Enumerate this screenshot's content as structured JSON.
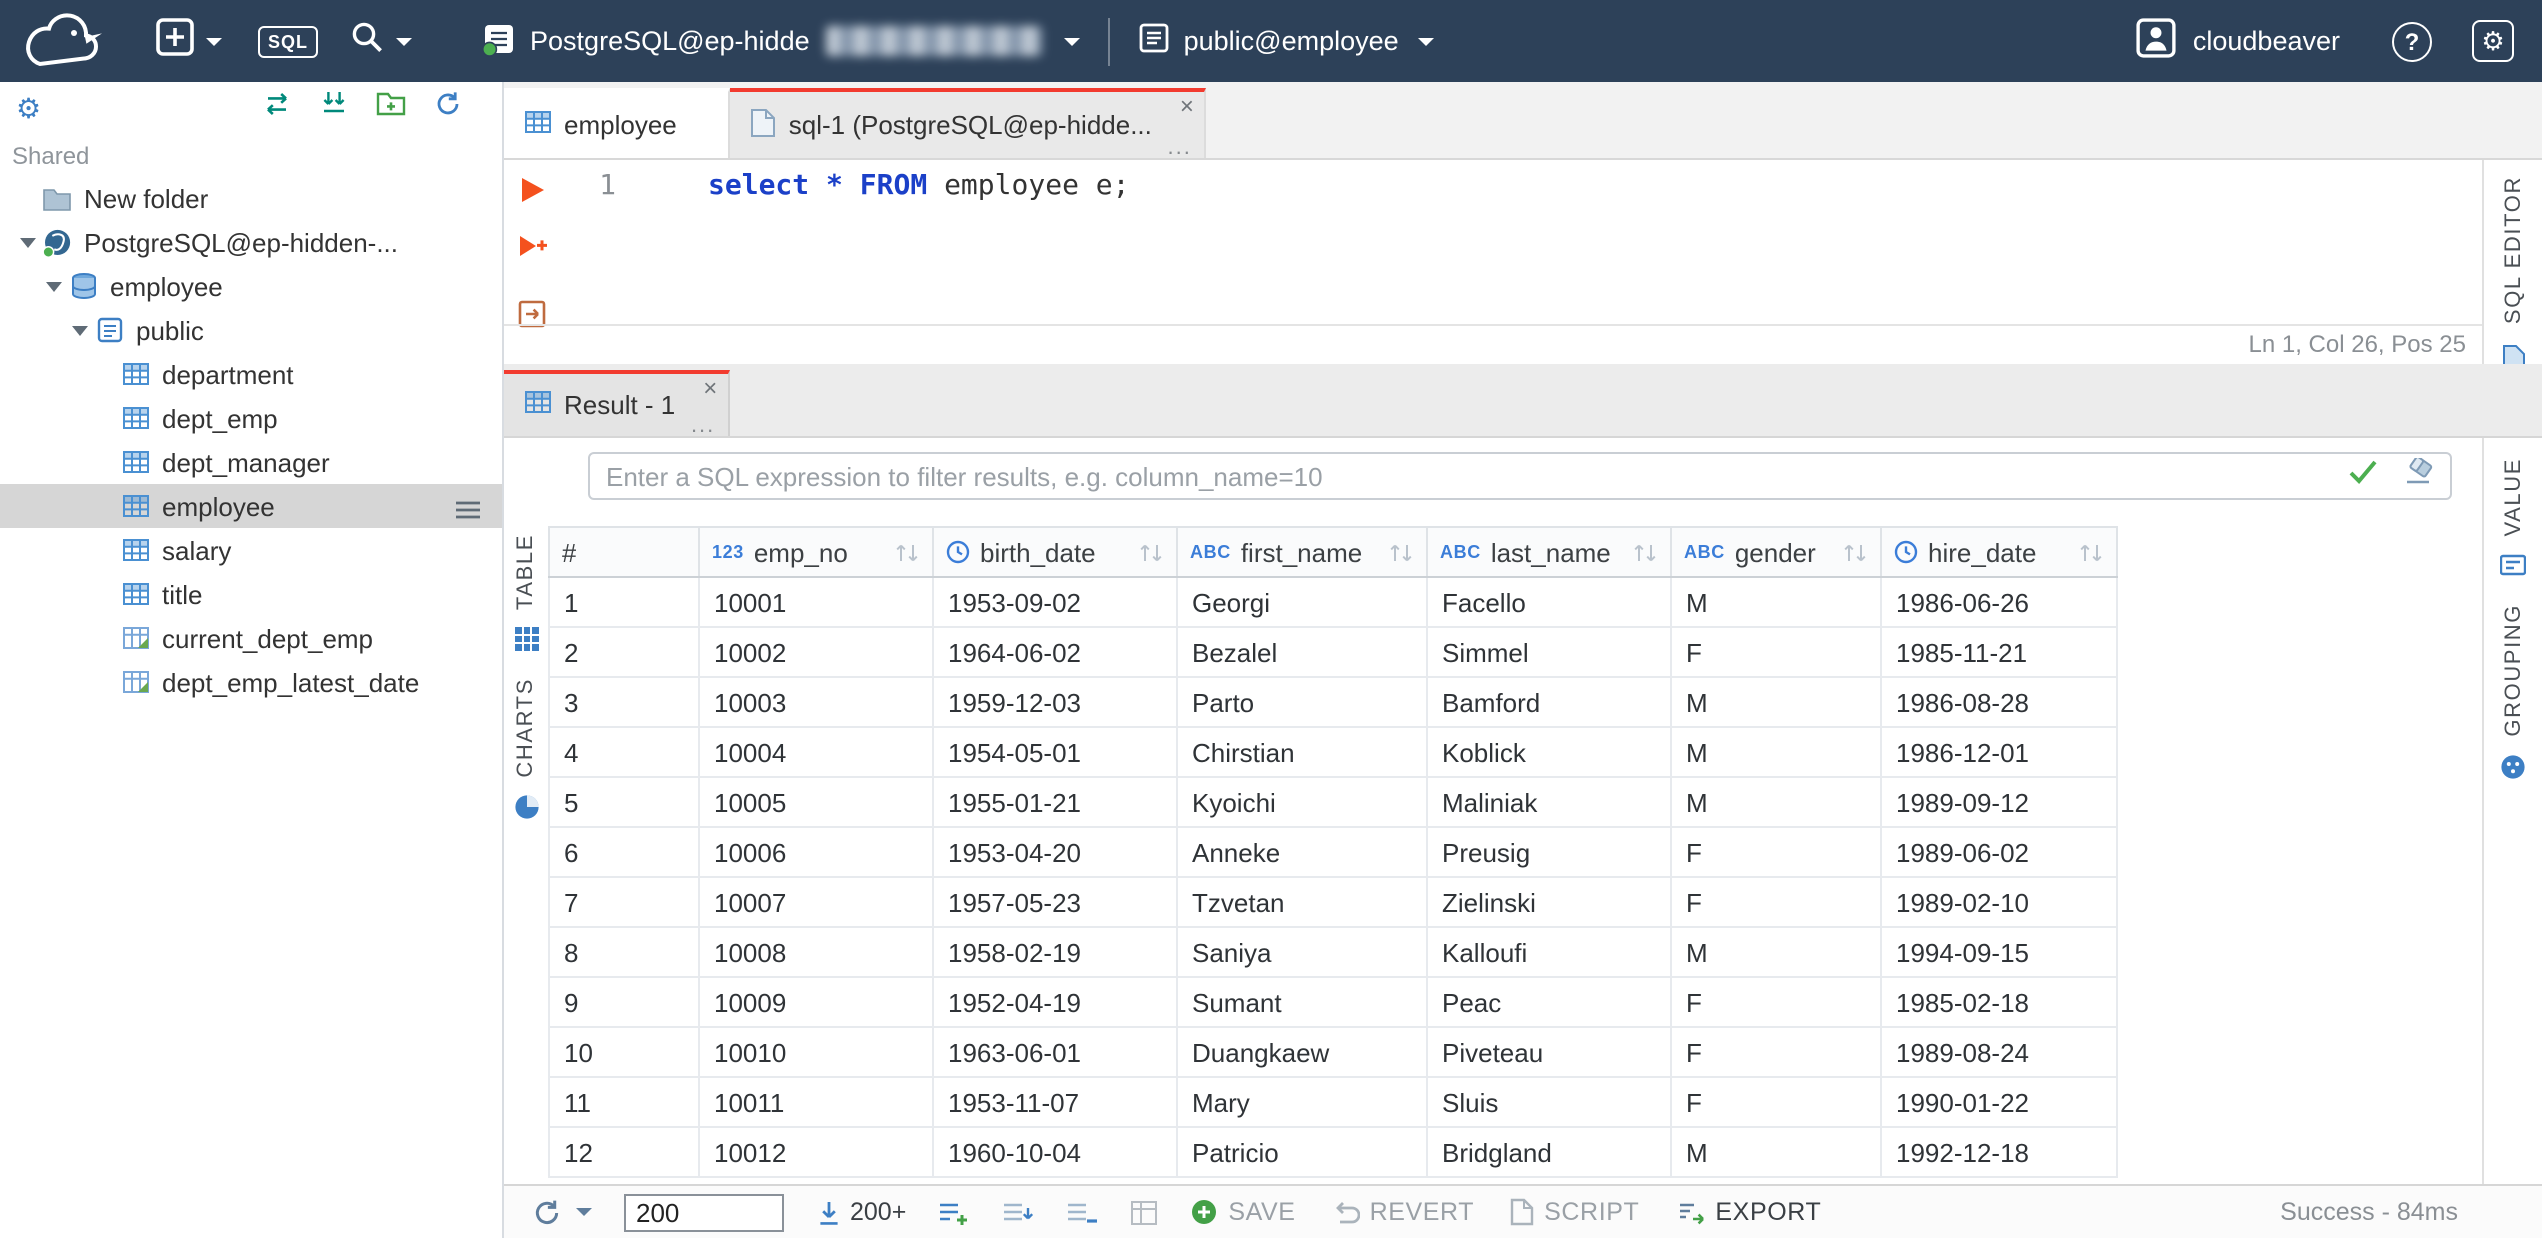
{
  "topbar": {
    "sql_badge": "SQL",
    "connection_name": "PostgreSQL@ep-hidde",
    "schema_selector": "public@employee",
    "user_name": "cloudbeaver",
    "help_label": "?"
  },
  "sidebar": {
    "section_label": "Shared",
    "tree": [
      {
        "label": "New folder",
        "icon": "folder",
        "indent": 0,
        "chevron": false
      },
      {
        "label": "PostgreSQL@ep-hidden-...",
        "icon": "postgres",
        "indent": 0,
        "chevron": true,
        "expanded": true
      },
      {
        "label": "employee",
        "icon": "database",
        "indent": 1,
        "chevron": true,
        "expanded": true
      },
      {
        "label": "public",
        "icon": "schema",
        "indent": 2,
        "chevron": true,
        "expanded": true
      },
      {
        "label": "department",
        "icon": "table",
        "indent": 3,
        "chevron": false
      },
      {
        "label": "dept_emp",
        "icon": "table",
        "indent": 3,
        "chevron": false
      },
      {
        "label": "dept_manager",
        "icon": "table",
        "indent": 3,
        "chevron": false
      },
      {
        "label": "employee",
        "icon": "table",
        "indent": 3,
        "chevron": false,
        "selected": true
      },
      {
        "label": "salary",
        "icon": "table",
        "indent": 3,
        "chevron": false
      },
      {
        "label": "title",
        "icon": "table",
        "indent": 3,
        "chevron": false
      },
      {
        "label": "current_dept_emp",
        "icon": "view",
        "indent": 3,
        "chevron": false
      },
      {
        "label": "dept_emp_latest_date",
        "icon": "view",
        "indent": 3,
        "chevron": false
      }
    ]
  },
  "tabs": {
    "items": [
      {
        "label": "employee",
        "active": false
      },
      {
        "label": "sql-1 (PostgreSQL@ep-hidde...",
        "active": true,
        "close": "×",
        "more": "..."
      }
    ]
  },
  "editor": {
    "line_number": "1",
    "tokens": [
      {
        "text": "select",
        "type": "kw"
      },
      {
        "text": " ",
        "type": "pl"
      },
      {
        "text": "*",
        "type": "kw"
      },
      {
        "text": " ",
        "type": "pl"
      },
      {
        "text": "FROM",
        "type": "kw"
      },
      {
        "text": " employee e;",
        "type": "pl"
      }
    ],
    "status": "Ln 1, Col 26, Pos 25",
    "rail_label": "SQL EDITOR"
  },
  "result": {
    "tab_label": "Result - 1",
    "tab_close": "×",
    "tab_more": "...",
    "filter_placeholder": "Enter a SQL expression to filter results, e.g. column_name=10",
    "rails": {
      "table": "TABLE",
      "charts": "CHARTS",
      "value": "VALUE",
      "grouping": "GROUPING"
    },
    "grid": {
      "columns": [
        {
          "name": "#",
          "type": ""
        },
        {
          "name": "emp_no",
          "type": "123"
        },
        {
          "name": "birth_date",
          "type": "date"
        },
        {
          "name": "first_name",
          "type": "ABC"
        },
        {
          "name": "last_name",
          "type": "ABC"
        },
        {
          "name": "gender",
          "type": "ABC"
        },
        {
          "name": "hire_date",
          "type": "date"
        }
      ],
      "rows": [
        [
          "1",
          "10001",
          "1953-09-02",
          "Georgi",
          "Facello",
          "M",
          "1986-06-26"
        ],
        [
          "2",
          "10002",
          "1964-06-02",
          "Bezalel",
          "Simmel",
          "F",
          "1985-11-21"
        ],
        [
          "3",
          "10003",
          "1959-12-03",
          "Parto",
          "Bamford",
          "M",
          "1986-08-28"
        ],
        [
          "4",
          "10004",
          "1954-05-01",
          "Chirstian",
          "Koblick",
          "M",
          "1986-12-01"
        ],
        [
          "5",
          "10005",
          "1955-01-21",
          "Kyoichi",
          "Maliniak",
          "M",
          "1989-09-12"
        ],
        [
          "6",
          "10006",
          "1953-04-20",
          "Anneke",
          "Preusig",
          "F",
          "1989-06-02"
        ],
        [
          "7",
          "10007",
          "1957-05-23",
          "Tzvetan",
          "Zielinski",
          "F",
          "1989-02-10"
        ],
        [
          "8",
          "10008",
          "1958-02-19",
          "Saniya",
          "Kalloufi",
          "M",
          "1994-09-15"
        ],
        [
          "9",
          "10009",
          "1952-04-19",
          "Sumant",
          "Peac",
          "F",
          "1985-02-18"
        ],
        [
          "10",
          "10010",
          "1963-06-01",
          "Duangkaew",
          "Piveteau",
          "F",
          "1989-08-24"
        ],
        [
          "11",
          "10011",
          "1953-11-07",
          "Mary",
          "Sluis",
          "F",
          "1990-01-22"
        ],
        [
          "12",
          "10012",
          "1960-10-04",
          "Patricio",
          "Bridgland",
          "M",
          "1992-12-18"
        ]
      ]
    },
    "toolbar": {
      "fetch_size": "200",
      "fetch_more_label": "200+",
      "save": "SAVE",
      "revert": "REVERT",
      "script": "SCRIPT",
      "export": "EXPORT",
      "status": "Success - 84ms"
    }
  }
}
